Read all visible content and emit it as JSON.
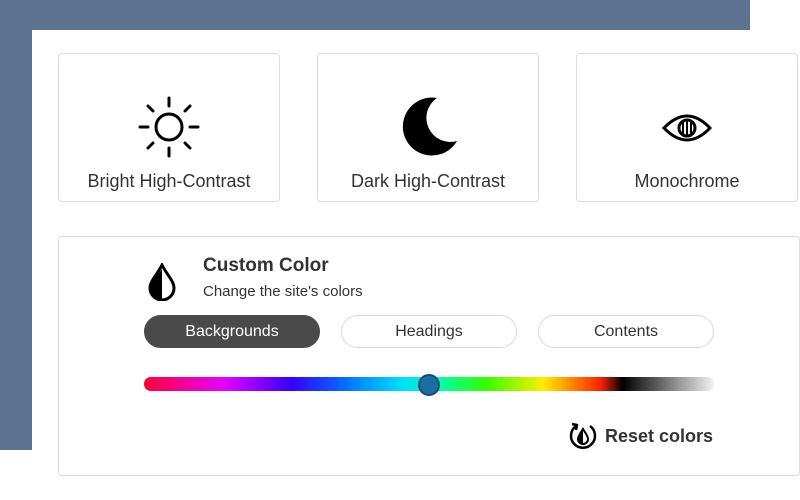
{
  "modes": [
    {
      "label": "Bright High-Contrast",
      "icon": "sun-icon"
    },
    {
      "label": "Dark High-Contrast",
      "icon": "moon-icon"
    },
    {
      "label": "Monochrome",
      "icon": "eye-icon"
    }
  ],
  "custom_color": {
    "title": "Custom Color",
    "subtitle": "Change the site's colors",
    "icon": "water-drop-icon",
    "tabs": [
      {
        "label": "Backgrounds",
        "active": true
      },
      {
        "label": "Headings",
        "active": false
      },
      {
        "label": "Contents",
        "active": false
      }
    ],
    "slider_value": 0.5,
    "reset_label": "Reset colors",
    "reset_icon": "reset-drop-icon"
  },
  "colors": {
    "background_band": "#5b7390",
    "active_tab": "#4a4a4a",
    "slider_thumb": "#1d6ea0"
  }
}
